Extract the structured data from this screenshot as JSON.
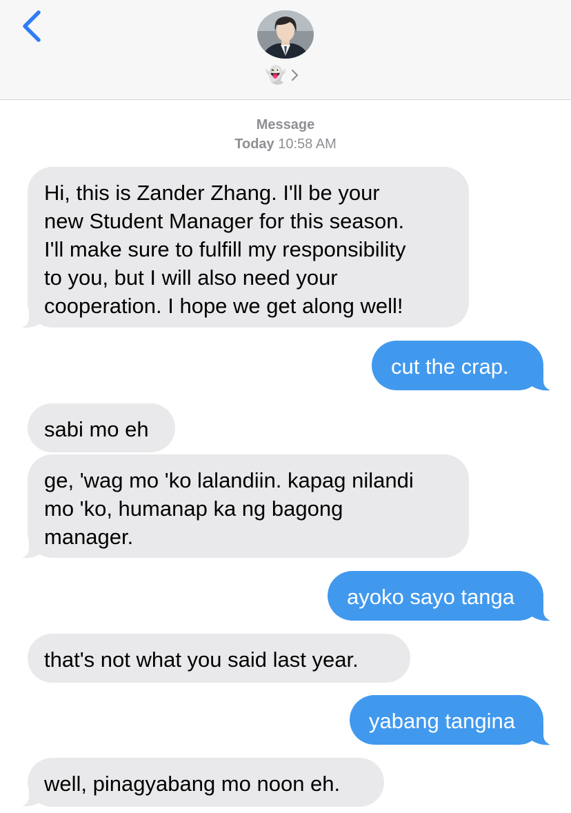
{
  "header": {
    "contact_emoji": "👻"
  },
  "meta": {
    "service": "Message",
    "day": "Today",
    "time": "10:58 AM"
  },
  "messages": [
    {
      "direction": "incoming",
      "lines": [
        "Hi, this is Zander Zhang. I'll be your",
        "new Student Manager for this season.",
        "I'll make sure to fulfill my responsibility",
        "to you, but I will also need your",
        "cooperation. I hope we get along well!"
      ]
    },
    {
      "direction": "outgoing",
      "lines": [
        "cut the crap."
      ]
    },
    {
      "direction": "incoming",
      "lines": [
        "sabi mo eh"
      ]
    },
    {
      "direction": "incoming",
      "lines": [
        "ge, 'wag mo 'ko lalandiin. kapag nilandi",
        "mo 'ko, humanap ka ng bagong",
        "manager."
      ]
    },
    {
      "direction": "outgoing",
      "lines": [
        "ayoko sayo tanga"
      ]
    },
    {
      "direction": "incoming",
      "lines": [
        "that's not what you said last year."
      ]
    },
    {
      "direction": "outgoing",
      "lines": [
        "yabang tangina"
      ]
    },
    {
      "direction": "incoming",
      "lines": [
        "well, pinagyabang mo noon eh."
      ]
    }
  ],
  "colors": {
    "header_bg": "#f7f7f7",
    "accent_blue": "#2f7cf6",
    "incoming_bubble": "#e9e9eb",
    "outgoing_bubble": "#4199ee",
    "meta_text": "#8e8e93"
  }
}
